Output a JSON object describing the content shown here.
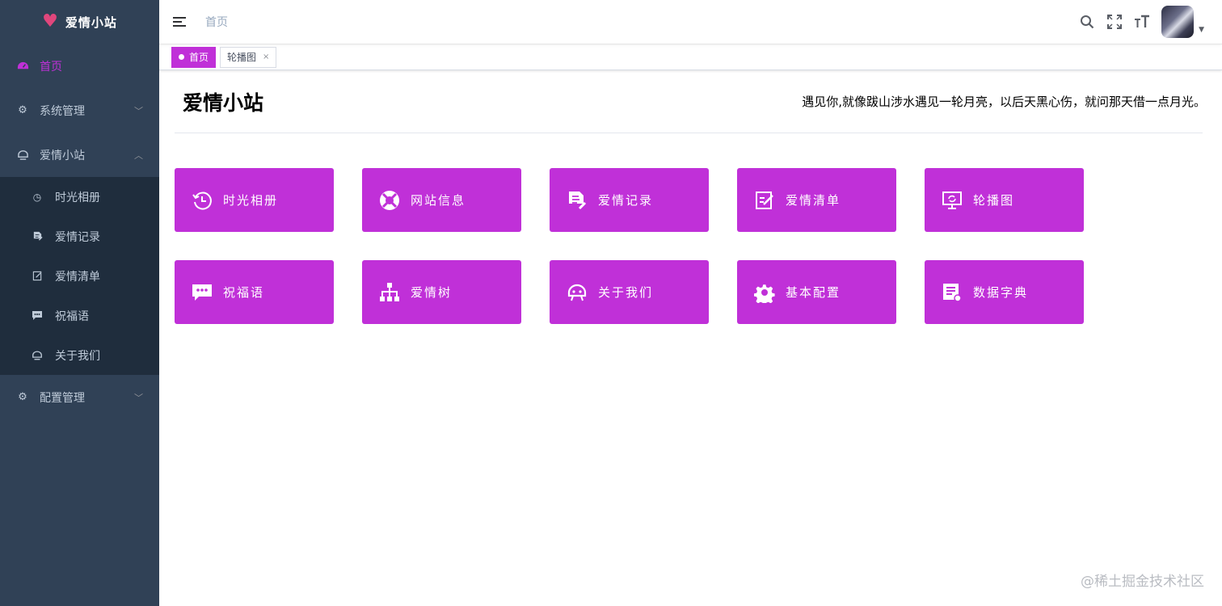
{
  "app": {
    "title": "爱情小站"
  },
  "sidebar": {
    "items": [
      {
        "label": "首页",
        "icon": "dashboard-icon",
        "active": true
      },
      {
        "label": "系统管理",
        "icon": "gear-icon",
        "expandable": true
      },
      {
        "label": "爱情小站",
        "icon": "couple-icon",
        "expandable": true,
        "expanded": true
      },
      {
        "label": "配置管理",
        "icon": "gear-icon",
        "expandable": true
      }
    ],
    "submenu": [
      {
        "label": "时光相册",
        "icon": "history-icon"
      },
      {
        "label": "爱情记录",
        "icon": "document-edit-icon"
      },
      {
        "label": "爱情清单",
        "icon": "checklist-icon"
      },
      {
        "label": "祝福语",
        "icon": "chat-icon"
      },
      {
        "label": "关于我们",
        "icon": "robot-icon"
      }
    ]
  },
  "topbar": {
    "breadcrumb": "首页"
  },
  "tags": [
    {
      "label": "首页",
      "active": true
    },
    {
      "label": "轮播图",
      "closable": "×"
    }
  ],
  "content": {
    "title": "爱情小站",
    "quote": "遇见你,就像跋山涉水遇见一轮月亮，以后天黑心伤，就问那天借一点月光。",
    "cards": [
      {
        "label": "时光相册",
        "icon": "history-icon"
      },
      {
        "label": "网站信息",
        "icon": "lifebuoy-icon"
      },
      {
        "label": "爱情记录",
        "icon": "document-edit-icon"
      },
      {
        "label": "爱情清单",
        "icon": "checklist-icon"
      },
      {
        "label": "轮播图",
        "icon": "monitor-icon"
      },
      {
        "label": "祝福语",
        "icon": "chat-icon"
      },
      {
        "label": "爱情树",
        "icon": "tree-icon"
      },
      {
        "label": "关于我们",
        "icon": "robot-icon"
      },
      {
        "label": "基本配置",
        "icon": "gear-icon"
      },
      {
        "label": "数据字典",
        "icon": "dictionary-icon"
      }
    ]
  },
  "watermark": "@稀土掘金技术社区",
  "colors": {
    "accent": "#c030d8",
    "sidebar_bg": "#304156",
    "submenu_bg": "#1f2d3d"
  }
}
